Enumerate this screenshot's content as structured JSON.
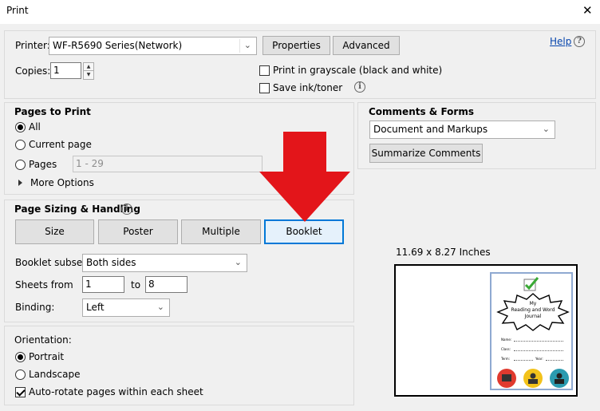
{
  "window": {
    "title": "Print",
    "close_glyph": "✕"
  },
  "printer": {
    "label": "Printer:",
    "value": "WF-R5690 Series(Network)",
    "properties_label": "Properties",
    "advanced_label": "Advanced",
    "help_label": "Help",
    "help_icon": "?"
  },
  "copies": {
    "label": "Copies:",
    "value": "1",
    "grayscale_label": "Print in grayscale (black and white)",
    "grayscale_checked": false,
    "save_ink_label": "Save ink/toner",
    "save_ink_checked": false
  },
  "pages_to_print": {
    "heading": "Pages to Print",
    "all_label": "All",
    "current_label": "Current page",
    "pages_label": "Pages",
    "pages_value": "1 - 29",
    "more_options_label": "More Options",
    "selected": "all"
  },
  "comments_forms": {
    "heading": "Comments & Forms",
    "value": "Document and Markups",
    "summarize_label": "Summarize Comments"
  },
  "sizing": {
    "heading": "Page Sizing & Handling",
    "tabs": [
      {
        "label": "Size",
        "selected": false
      },
      {
        "label": "Poster",
        "selected": false
      },
      {
        "label": "Multiple",
        "selected": false
      },
      {
        "label": "Booklet",
        "selected": true
      }
    ],
    "subset_label": "Booklet subset:",
    "subset_value": "Both sides",
    "sheets_from_label": "Sheets from",
    "sheets_from_value": "1",
    "sheets_to_label": "to",
    "sheets_to_value": "8",
    "binding_label": "Binding:",
    "binding_value": "Left"
  },
  "orientation": {
    "heading": "Orientation:",
    "portrait_label": "Portrait",
    "landscape_label": "Landscape",
    "selected": "portrait",
    "autorotate_label": "Auto-rotate pages within each sheet",
    "autorotate_checked": true
  },
  "preview": {
    "size_label": "11.69 x 8.27 Inches",
    "journal_title_line1": "My",
    "journal_title_line2": "Reading and Word",
    "journal_title_line3": "Journal",
    "field_name": "Name:",
    "field_class": "Class:",
    "field_term": "Term:",
    "field_year": "Year:"
  },
  "annotation": {
    "arrow_color": "#e3151a",
    "icon": "down-arrow-icon"
  },
  "colors": {
    "accent": "#0078d7",
    "link": "#0645ad"
  }
}
